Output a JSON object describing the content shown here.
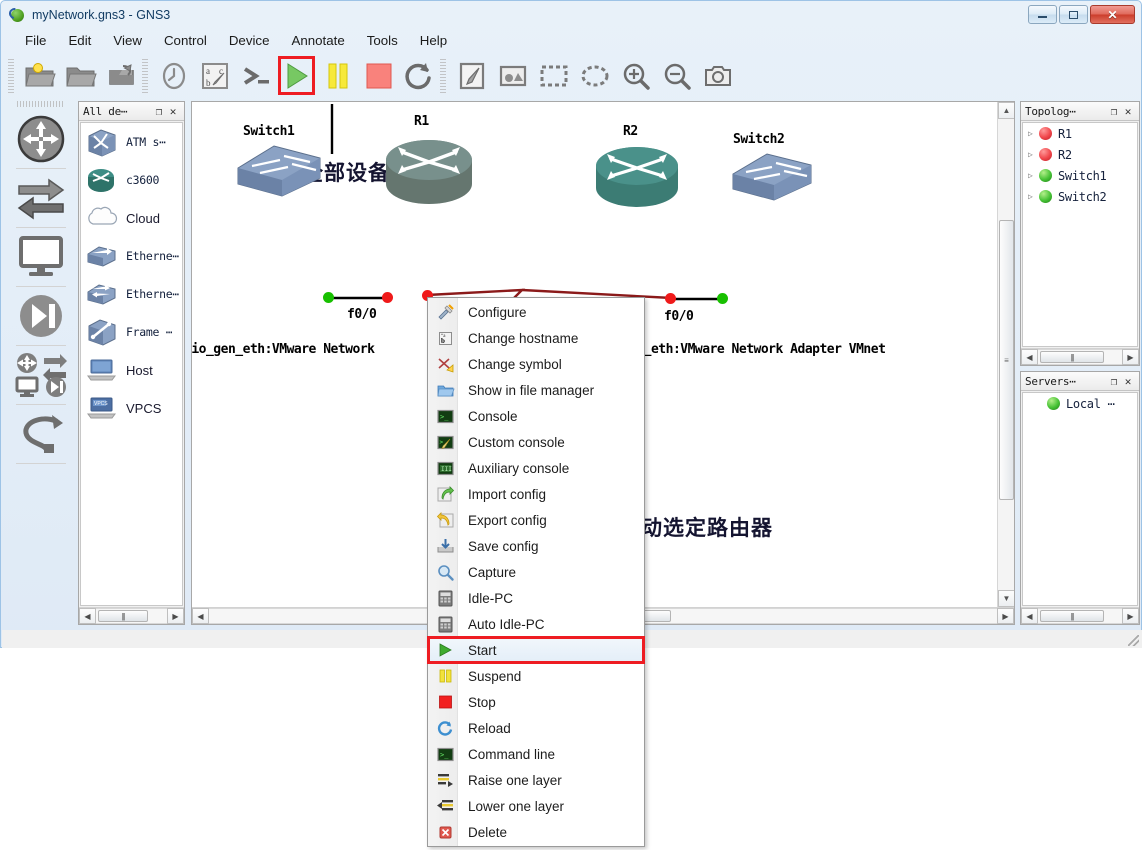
{
  "window": {
    "title": "myNetwork.gns3 - GNS3",
    "icon": "gns3-logo-icon",
    "buttons": {
      "minimize": "minimize",
      "maximize": "maximize",
      "close": "close"
    }
  },
  "menubar": {
    "items": [
      {
        "label": "File"
      },
      {
        "label": "Edit"
      },
      {
        "label": "View"
      },
      {
        "label": "Control"
      },
      {
        "label": "Device"
      },
      {
        "label": "Annotate"
      },
      {
        "label": "Tools"
      },
      {
        "label": "Help"
      }
    ]
  },
  "toolbar": {
    "groups": [
      {
        "buttons": [
          {
            "name": "new-project-icon",
            "title": "New project"
          },
          {
            "name": "open-project-icon",
            "title": "Open project"
          },
          {
            "name": "save-project-icon",
            "title": "Save project"
          }
        ]
      },
      {
        "buttons": [
          {
            "name": "snapshot-clock-icon",
            "title": "Snapshot"
          },
          {
            "name": "show-hide-interface-labels-icon",
            "title": "Show/hide interface labels"
          },
          {
            "name": "console-to-all-devices-icon",
            "title": "Console connect to all devices"
          },
          {
            "name": "start-all-devices-icon",
            "title": "Start all devices",
            "highlighted": true
          },
          {
            "name": "suspend-all-devices-icon",
            "title": "Suspend all devices"
          },
          {
            "name": "stop-all-devices-icon",
            "title": "Stop all devices"
          },
          {
            "name": "reload-all-devices-icon",
            "title": "Reload all devices"
          }
        ]
      },
      {
        "buttons": [
          {
            "name": "add-note-icon",
            "title": "Add a note"
          },
          {
            "name": "insert-picture-icon",
            "title": "Insert a picture"
          },
          {
            "name": "draw-rectangle-icon",
            "title": "Draw a rectangle"
          },
          {
            "name": "draw-ellipse-icon",
            "title": "Draw an ellipse"
          },
          {
            "name": "zoom-in-icon",
            "title": "Zoom in"
          },
          {
            "name": "zoom-out-icon",
            "title": "Zoom out"
          },
          {
            "name": "screenshot-icon",
            "title": "Take a screenshot"
          }
        ]
      }
    ]
  },
  "leftbar": {
    "items": [
      {
        "name": "routers-icon",
        "title": "Routers"
      },
      {
        "name": "switches-icon",
        "title": "Switches"
      },
      {
        "name": "end-devices-icon",
        "title": "End devices"
      },
      {
        "name": "security-devices-icon",
        "title": "Security devices"
      },
      {
        "name": "all-devices-icon",
        "title": "All devices"
      },
      {
        "name": "add-link-icon",
        "title": "Add a link"
      }
    ]
  },
  "device_panel": {
    "title": "All de⋯",
    "float_icon": "float-icon",
    "close_icon": "close-icon",
    "items": [
      {
        "label": "ATM s⋯",
        "icon": "atm-switch-icon",
        "mono": true
      },
      {
        "label": "c3600",
        "icon": "router-c3600-icon",
        "mono": true
      },
      {
        "label": "Cloud",
        "icon": "cloud-icon",
        "mono": false
      },
      {
        "label": "Etherne⋯",
        "icon": "ethernet-hub-icon",
        "mono": true
      },
      {
        "label": "Etherne⋯",
        "icon": "ethernet-switch-icon",
        "mono": true
      },
      {
        "label": "Frame ⋯",
        "icon": "frame-relay-switch-icon",
        "mono": true
      },
      {
        "label": "Host",
        "icon": "host-icon",
        "mono": false
      },
      {
        "label": "VPCS",
        "icon": "vpcs-icon",
        "mono": false
      }
    ]
  },
  "topology_panel": {
    "title": "Topolog⋯",
    "float_icon": "float-icon",
    "close_icon": "close-icon",
    "nodes": [
      {
        "label": "R1",
        "status": "red"
      },
      {
        "label": "R2",
        "status": "red"
      },
      {
        "label": "Switch1",
        "status": "green"
      },
      {
        "label": "Switch2",
        "status": "green"
      }
    ]
  },
  "servers_panel": {
    "title": "Servers⋯",
    "float_icon": "float-icon",
    "close_icon": "close-icon",
    "items": [
      {
        "label": "Local ⋯",
        "status": "green"
      }
    ]
  },
  "canvas": {
    "nodes": [
      {
        "name": "Switch1",
        "type": "switch",
        "label": "Switch1"
      },
      {
        "name": "R1",
        "type": "router",
        "label": "R1"
      },
      {
        "name": "R2",
        "type": "router",
        "label": "R2"
      },
      {
        "name": "Switch2",
        "type": "switch",
        "label": "Switch2"
      }
    ],
    "interface_labels": [
      {
        "text": "f0/0"
      },
      {
        "text": "f0/0"
      }
    ],
    "cloud_labels": [
      {
        "text": "nio_gen_eth:VMware Network"
      },
      {
        "text": "o_gen_eth:VMware Network Adapter VMnet"
      }
    ],
    "annotations": [
      {
        "text": "启动全部设备",
        "name": "annotation-start-all-devices"
      },
      {
        "text": "只启动选定路由器",
        "name": "annotation-start-selected-router"
      }
    ]
  },
  "context_menu": {
    "items": [
      {
        "label": "Configure",
        "icon": "configure-wrench-icon"
      },
      {
        "label": "Change hostname",
        "icon": "change-hostname-icon"
      },
      {
        "label": "Change symbol",
        "icon": "change-symbol-icon"
      },
      {
        "label": "Show in file manager",
        "icon": "folder-icon"
      },
      {
        "label": "Console",
        "icon": "console-icon"
      },
      {
        "label": "Custom console",
        "icon": "custom-console-icon"
      },
      {
        "label": "Auxiliary console",
        "icon": "auxiliary-console-icon"
      },
      {
        "label": "Import config",
        "icon": "import-config-icon"
      },
      {
        "label": "Export config",
        "icon": "export-config-icon"
      },
      {
        "label": "Save config",
        "icon": "save-config-icon"
      },
      {
        "label": "Capture",
        "icon": "capture-magnifier-icon"
      },
      {
        "label": "Idle-PC",
        "icon": "idle-pc-icon"
      },
      {
        "label": "Auto Idle-PC",
        "icon": "auto-idle-pc-icon"
      },
      {
        "label": "Start",
        "icon": "start-play-icon",
        "selected": true
      },
      {
        "label": "Suspend",
        "icon": "suspend-pause-icon"
      },
      {
        "label": "Stop",
        "icon": "stop-square-icon"
      },
      {
        "label": "Reload",
        "icon": "reload-circular-arrow-icon"
      },
      {
        "label": "Command line",
        "icon": "command-line-icon"
      },
      {
        "label": "Raise one layer",
        "icon": "raise-one-layer-icon"
      },
      {
        "label": "Lower one layer",
        "icon": "lower-one-layer-icon"
      },
      {
        "label": "Delete",
        "icon": "delete-icon"
      }
    ]
  },
  "colors": {
    "highlight_red": "#ee1c22",
    "led_red": "#f0464b",
    "led_green": "#46c235",
    "accent_blue": "#9dc3e6"
  }
}
